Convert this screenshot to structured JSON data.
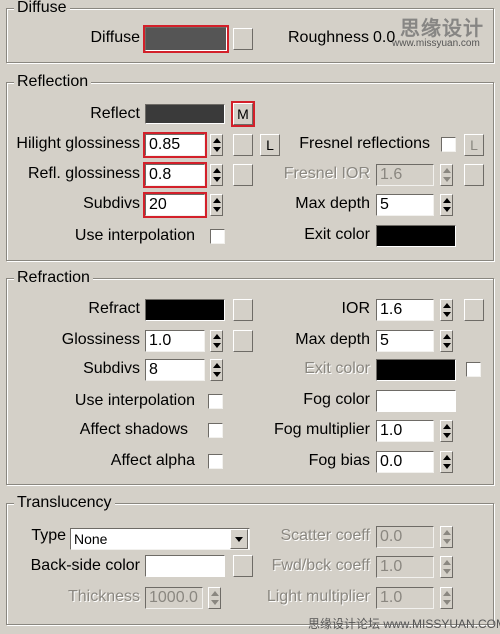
{
  "colors": {
    "panel_bg": "#d4d0c8",
    "highlight_red": "#d3202a",
    "diffuse_swatch": "#555555",
    "reflect_swatch": "#3a3a3a",
    "black": "#000000",
    "white": "#ffffff"
  },
  "diffuse": {
    "title": "Diffuse",
    "diffuse_label": "Diffuse",
    "roughness_label": "Roughness",
    "roughness_value": "0.0"
  },
  "reflection": {
    "title": "Reflection",
    "reflect_label": "Reflect",
    "reflect_map_button": "M",
    "hilight_label": "Hilight glossiness",
    "hilight_value": "0.85",
    "hilight_lock_button": "L",
    "fresnel_label": "Fresnel reflections",
    "fresnel_lock_button": "L",
    "refl_gloss_label": "Refl. glossiness",
    "refl_gloss_value": "0.8",
    "fresnel_ior_label": "Fresnel IOR",
    "fresnel_ior_value": "1.6",
    "subdivs_label": "Subdivs",
    "subdivs_value": "20",
    "max_depth_label": "Max depth",
    "max_depth_value": "5",
    "use_interp_label": "Use interpolation",
    "exit_color_label": "Exit color"
  },
  "refraction": {
    "title": "Refraction",
    "refract_label": "Refract",
    "ior_label": "IOR",
    "ior_value": "1.6",
    "glossiness_label": "Glossiness",
    "glossiness_value": "1.0",
    "max_depth_label": "Max depth",
    "max_depth_value": "5",
    "subdivs_label": "Subdivs",
    "subdivs_value": "8",
    "exit_color_label": "Exit color",
    "use_interp_label": "Use interpolation",
    "fog_color_label": "Fog color",
    "affect_shadows_label": "Affect shadows",
    "fog_multiplier_label": "Fog multiplier",
    "fog_multiplier_value": "1.0",
    "affect_alpha_label": "Affect alpha",
    "fog_bias_label": "Fog bias",
    "fog_bias_value": "0.0"
  },
  "translucency": {
    "title": "Translucency",
    "type_label": "Type",
    "type_value": "None",
    "scatter_label": "Scatter coeff",
    "scatter_value": "0.0",
    "backside_label": "Back-side color",
    "fwd_bck_label": "Fwd/bck coeff",
    "fwd_bck_value": "1.0",
    "thickness_label": "Thickness",
    "thickness_value": "1000.0",
    "light_mult_label": "Light multiplier",
    "light_mult_value": "1.0"
  },
  "watermark": {
    "logo_text": "思缘设计",
    "logo_url": "www.missyuan.com",
    "footer_text": "思缘设计论坛 www.MISSYUAN.COM"
  }
}
